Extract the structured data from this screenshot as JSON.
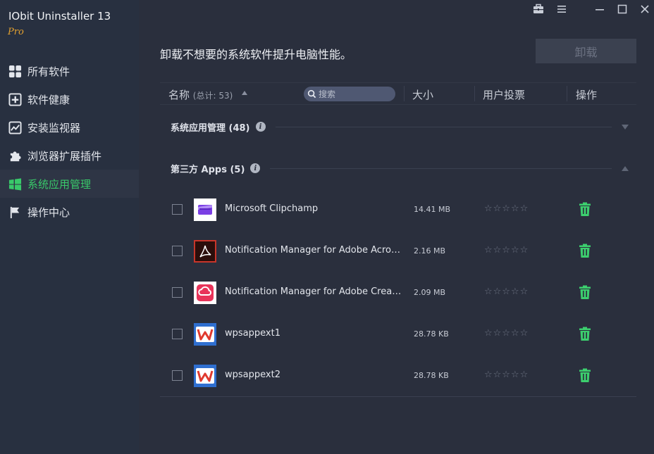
{
  "app": {
    "title": "IObit Uninstaller 13",
    "edition": "Pro"
  },
  "sidebar": {
    "items": [
      {
        "label": "所有软件",
        "icon": "grid-icon",
        "active": false
      },
      {
        "label": "软件健康",
        "icon": "medical-plus-icon",
        "active": false
      },
      {
        "label": "安装监视器",
        "icon": "chart-line-icon",
        "active": false
      },
      {
        "label": "浏览器扩展插件",
        "icon": "puzzle-icon",
        "active": false
      },
      {
        "label": "系统应用管理",
        "icon": "windows-icon",
        "active": true
      },
      {
        "label": "操作中心",
        "icon": "flag-icon",
        "active": false
      }
    ]
  },
  "window_controls": [
    "toolbox-icon",
    "menu-icon",
    "minimize-icon",
    "maximize-icon",
    "close-icon"
  ],
  "main": {
    "headline": "卸载不想要的系统软件提升电脑性能。",
    "uninstall_label": "卸载",
    "columns": {
      "name": "名称",
      "total": "(总计: 53)",
      "search_placeholder": "搜索",
      "size": "大小",
      "rating": "用户投票",
      "action": "操作"
    },
    "groups": [
      {
        "title": "系统应用管理 (48)",
        "expanded": false
      },
      {
        "title": "第三方 Apps (5)",
        "expanded": true
      }
    ],
    "apps": [
      {
        "name": "Microsoft Clipchamp",
        "size": "14.41 MB",
        "stars": "☆☆☆☆☆",
        "icon": "clipchamp-icon"
      },
      {
        "name": "Notification Manager for Adobe Acrobat",
        "size": "2.16 MB",
        "stars": "☆☆☆☆☆",
        "icon": "acrobat-icon"
      },
      {
        "name": "Notification Manager for Adobe Creativ...",
        "size": "2.09 MB",
        "stars": "☆☆☆☆☆",
        "icon": "creative-cloud-icon"
      },
      {
        "name": "wpsappext1",
        "size": "28.78 KB",
        "stars": "☆☆☆☆☆",
        "icon": "wps-icon"
      },
      {
        "name": "wpsappext2",
        "size": "28.78 KB",
        "stars": "☆☆☆☆☆",
        "icon": "wps-icon"
      }
    ]
  },
  "colors": {
    "accent": "#39c96a",
    "edition": "#e4a12f",
    "background": "#2a2f3d",
    "sidebar": "#283040"
  }
}
